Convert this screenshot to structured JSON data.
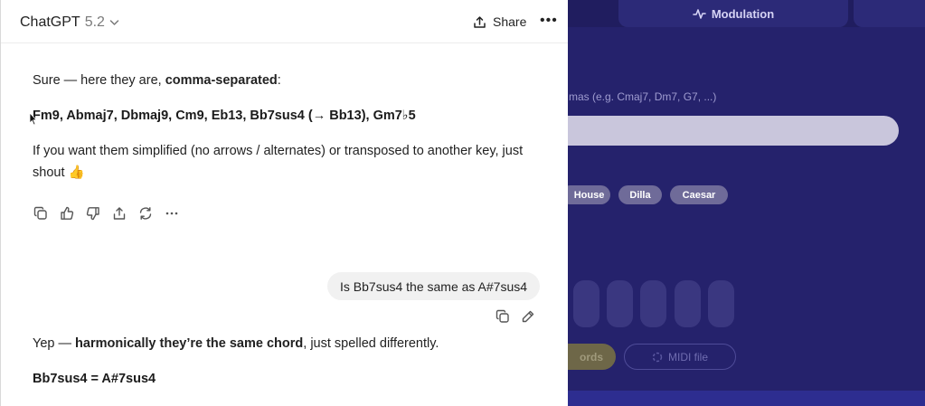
{
  "background_app": {
    "tab_modulation": "Modulation",
    "hint": "mas (e.g. Cmaj7, Dm7, G7, ...)",
    "chips": [
      "House",
      "Dilla",
      "Caesar"
    ],
    "button_chords": "ords",
    "button_midi": "MIDI file"
  },
  "chat": {
    "model_name": "ChatGPT",
    "model_version": "5.2",
    "share_label": "Share",
    "reply1": {
      "intro_prefix": "Sure — here they are, ",
      "intro_bold": "comma-separated",
      "intro_suffix": ":",
      "chords": "Fm9, Abmaj7, Dbmaj9, Cm9, Eb13, Bb7sus4 (→ Bb13), Gm7♭5",
      "followup": "If you want them simplified (no arrows / alternates) or transposed to another key, just shout 👍"
    },
    "user_message": "Is Bb7sus4 the same as A#7sus4",
    "reply2": {
      "prefix": "Yep — ",
      "bold": "harmonically they’re the same chord",
      "suffix": ", just spelled differently.",
      "equation": "Bb7sus4 = A#7sus4"
    },
    "action_icons": [
      "copy-icon",
      "thumbs-up-icon",
      "thumbs-down-icon",
      "share-icon",
      "regenerate-icon",
      "more-icon"
    ],
    "user_action_icons": [
      "copy-icon",
      "edit-icon"
    ]
  }
}
